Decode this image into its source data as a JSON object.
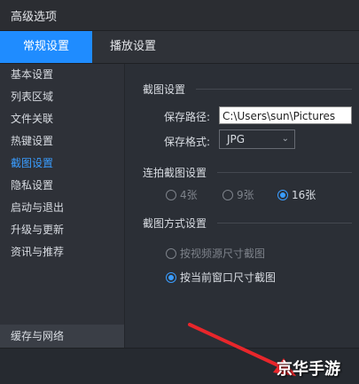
{
  "window": {
    "title": "高级选项"
  },
  "tabs": [
    {
      "label": "常规设置",
      "active": true
    },
    {
      "label": "播放设置",
      "active": false
    }
  ],
  "sidebar": {
    "items": [
      {
        "label": "基本设置"
      },
      {
        "label": "列表区域"
      },
      {
        "label": "文件关联"
      },
      {
        "label": "热键设置"
      },
      {
        "label": "截图设置",
        "active": true
      },
      {
        "label": "隐私设置"
      },
      {
        "label": "启动与退出"
      },
      {
        "label": "升级与更新"
      },
      {
        "label": "资讯与推荐"
      }
    ],
    "bottom_item": {
      "label": "缓存与网络"
    }
  },
  "screenshot": {
    "section_title": "截图设置",
    "path_label": "保存路径:",
    "path_value": "C:\\Users\\sun\\Pictures",
    "format_label": "保存格式:",
    "format_value": "JPG"
  },
  "burst": {
    "section_title": "连拍截图设置",
    "options": [
      {
        "label": "4张",
        "checked": false
      },
      {
        "label": "9张",
        "checked": false
      },
      {
        "label": "16张",
        "checked": true
      }
    ]
  },
  "method": {
    "section_title": "截图方式设置",
    "options": [
      {
        "label": "按视频源尺寸截图",
        "checked": false
      },
      {
        "label": "按当前窗口尺寸截图",
        "checked": true
      }
    ]
  },
  "watermark": "京华手游",
  "colors": {
    "accent": "#1f8cff",
    "active_text": "#3a9dff",
    "arrow": "#e8262b"
  }
}
